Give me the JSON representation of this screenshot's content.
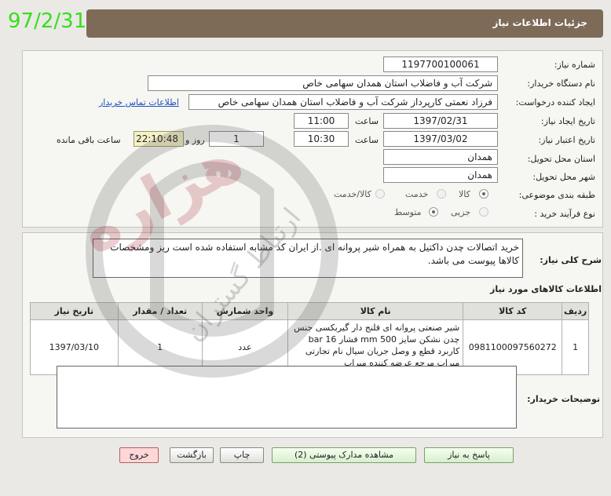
{
  "date_stamp": "97/2/31",
  "header": {
    "title": "جزئیات اطلاعات نیاز"
  },
  "fields": {
    "need_number_label": "شماره نیاز:",
    "need_number": "1197700100061",
    "buyer_org_label": "نام دستگاه خریدار:",
    "buyer_org": "شرکت آب و فاضلاب استان همدان سهامی خاص",
    "requester_label": "ایجاد کننده درخواست:",
    "requester": "فرزاد نعمتی کارپرداز شرکت آب و فاضلاب استان همدان سهامی خاص",
    "contact_link": "اطلاعات تماس خریدار",
    "created_label": "تاریخ ایجاد نیاز:",
    "created_date": "1397/02/31",
    "time_label": "ساعت",
    "created_time": "11:00",
    "validity_label": "تاریخ اعتبار نیاز:",
    "validity_date": "1397/03/02",
    "validity_time": "10:30",
    "days_value": "1",
    "days_label": "روز و",
    "remaining_time": "22:10:48",
    "remaining_label": "ساعت باقی مانده",
    "province_label": "استان محل تحویل:",
    "province": "همدان",
    "city_label": "شهر محل تحویل:",
    "city": "همدان",
    "category_label": "طبقه بندی موضوعی:",
    "category_options": [
      "کالا",
      "خدمت",
      "کالا/خدمت"
    ],
    "purchase_type_label": "نوع فرآیند خرید :",
    "purchase_options": [
      "جزیی",
      "متوسط"
    ]
  },
  "summary": {
    "label": "شرح کلی نیاز:",
    "text": "خرید اتصالات چدن داکتیل به همراه شیر پروانه ای .از ایران کد مشابه استفاده شده است ریز ومشخصات کالاها پیوست می باشد."
  },
  "items_section": {
    "title": "اطلاعات کالاهای مورد نیاز",
    "columns": [
      "ردیف",
      "کد کالا",
      "نام کالا",
      "واحد شمارش",
      "تعداد / مقدار",
      "تاریخ نیاز"
    ],
    "rows": [
      {
        "row": "1",
        "code": "0981100097560272",
        "name": "شیر صنعتی پروانه ای فلنج دار گیربکسی جنس چدن نشکن سایز mm 500 فشار bar 16 کاربرد قطع و وصل جریان سیال نام تجارتی میراب مرجع عرضه کننده میراب",
        "unit": "عدد",
        "qty": "1",
        "date": "1397/03/10"
      }
    ]
  },
  "buyer_notes": {
    "label": "توضیحات خریدار:",
    "text": ""
  },
  "buttons": {
    "reply": "پاسخ به نیاز",
    "attachments": "مشاهده مدارک پیوستی (2)",
    "print": "چاپ",
    "back": "بازگشت",
    "exit": "خروج"
  },
  "watermark": {
    "main": "هزاره",
    "sub": "ارتباط گستران"
  }
}
